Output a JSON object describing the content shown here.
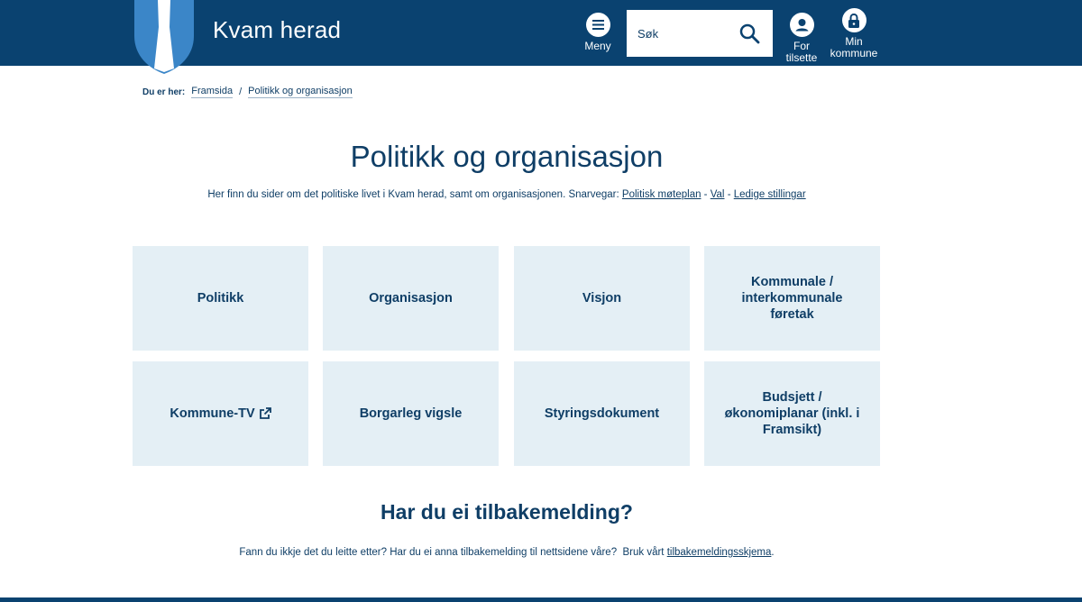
{
  "header": {
    "site_title": "Kvam herad",
    "menu_label": "Meny",
    "search_placeholder": "Søk",
    "staff_label": "For tilsette",
    "my_municipality_label": "Min kommune",
    "colors": {
      "bar": "#0a4270",
      "shield": "#3b86c8"
    }
  },
  "breadcrumb": {
    "lead": "Du er her:",
    "items": [
      "Framsida",
      "Politikk og organisasjon"
    ],
    "separator": "/"
  },
  "main": {
    "title": "Politikk og organisasjon",
    "intro_text": "Her finn du sider om det politiske livet i Kvam herad, samt om organisasjonen. Snarvegar: ",
    "shortcuts": [
      "Politisk møteplan",
      "Val",
      "Ledige stillingar"
    ],
    "shortcut_separator": " - ",
    "tiles": [
      {
        "label": "Politikk"
      },
      {
        "label": "Organisasjon"
      },
      {
        "label": "Visjon"
      },
      {
        "label": "Kommunale / interkommunale føretak"
      },
      {
        "label": "Kommune-TV",
        "icon": "external-link-icon"
      },
      {
        "label": "Borgarleg vigsle"
      },
      {
        "label": "Styringsdokument"
      },
      {
        "label": "Budsjett / økonomiplanar (inkl. i Framsikt)"
      }
    ],
    "tile_color": "#e4eff5"
  },
  "feedback": {
    "title": "Har du ei tilbakemelding?",
    "text": "Fann du ikkje det du leitte etter? Har du ei anna tilbakemelding til nettsidene våre?  Bruk vårt ",
    "link": "tilbakemeldingsskjema",
    "end": "."
  }
}
